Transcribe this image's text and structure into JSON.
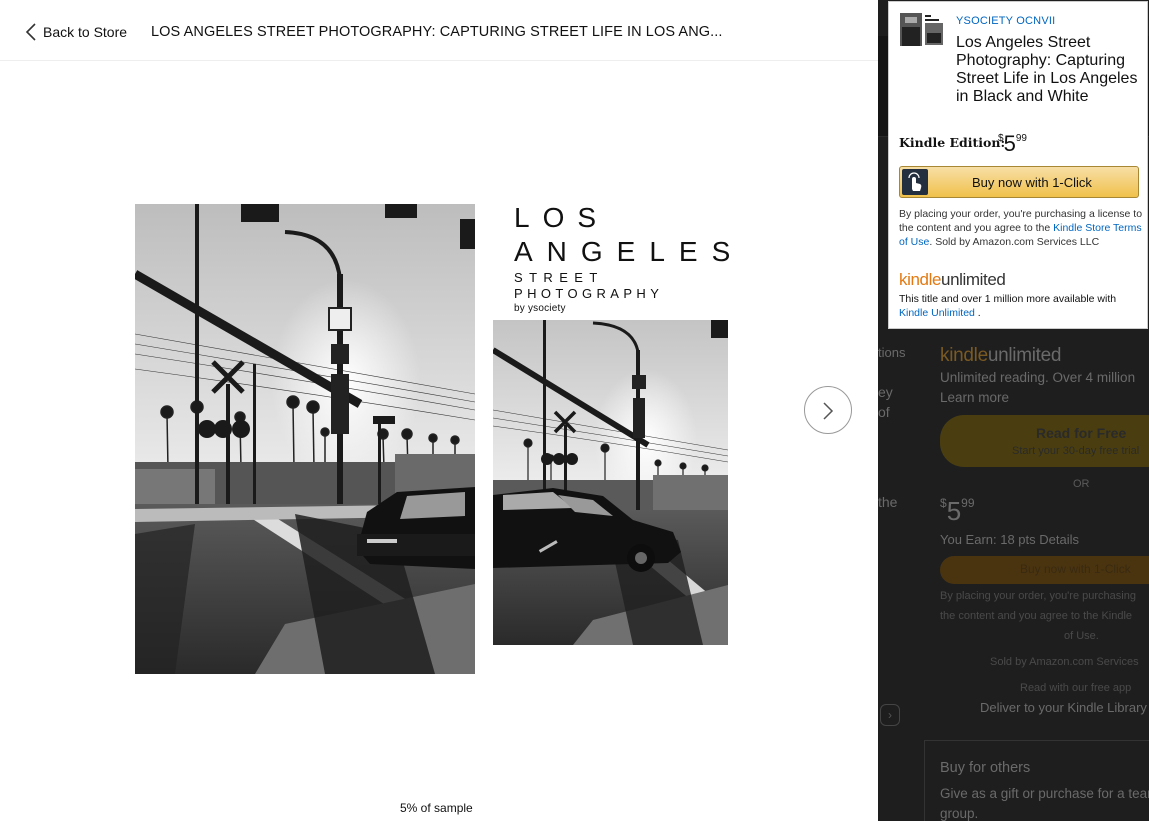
{
  "reader": {
    "back_label": "Back to Store",
    "title": "LOS ANGELES STREET PHOTOGRAPHY: CAPTURING STREET LIFE IN LOS ANG...",
    "cover": {
      "line1": "LOS",
      "line2": "ANGELES",
      "line3": "STREET",
      "line4": "PHOTOGRAPHY",
      "line5": "by ysociety"
    },
    "progress": "5% of sample"
  },
  "buybox": {
    "author": "YSOCIETY OCNVII",
    "title": "Los Angeles Street Photography: Capturing Street Life in Los Angeles in Black and White",
    "edition_label": "Kindle Edition:",
    "price_symbol": "$",
    "price_whole": "5",
    "price_fraction": "99",
    "buy_label": "Buy now with 1-Click",
    "legal_pre": "By placing your order, you're purchasing a license to the content and you agree to the ",
    "legal_link": "Kindle Store Terms of Use",
    "legal_post": ". Sold by Amazon.com Services LLC",
    "ku_kindle": "kindle",
    "ku_unlimited": "unlimited",
    "ku_text": "This title and over 1 million more available with ",
    "ku_link": "Kindle Unlimited",
    "ku_end": " ."
  },
  "background": {
    "frag_tions": "tions",
    "frag_ey": "ey",
    "frag_of": "of",
    "frag_the": "the",
    "ku_kindle": "kindle",
    "ku_unlimited": "unlimited",
    "unlimited_reading": "Unlimited reading. Over 4 million",
    "learn_more": "Learn more",
    "read_free": "Read for Free",
    "trial": "Start your 30-day free trial",
    "or": "OR",
    "price_symbol": "$",
    "price_whole": "5",
    "price_fraction": "99",
    "earn": "You Earn: 18 pts Details",
    "buy_label": "Buy now with 1-Click",
    "legal1": "By placing your order, you're purchasing",
    "legal2": "the content and you agree to the Kindle",
    "legal3": "of Use.",
    "sold_by": "Sold by Amazon.com Services",
    "read_app": "Read with our free app",
    "deliver": "Deliver to your Kindle Library",
    "buy_others": "Buy for others",
    "gift": "Give as a gift or purchase for a team or",
    "group": "group."
  },
  "colors": {
    "link": "#0066c0",
    "kindle_orange": "#e47911",
    "button_yellow": "#f0c14b"
  }
}
